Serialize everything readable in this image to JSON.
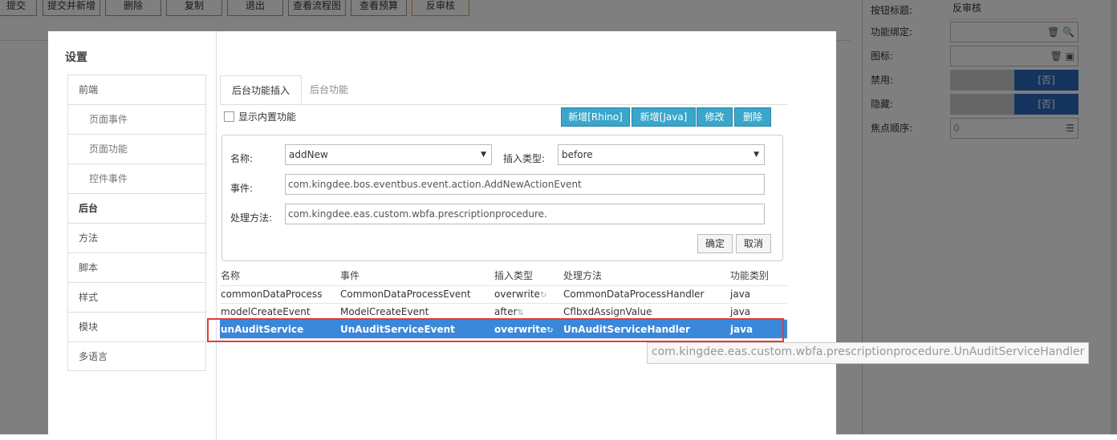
{
  "toolbar": {
    "buttons": [
      "提交",
      "提交并新增",
      "删除",
      "复制",
      "退出",
      "查看流程图",
      "查看预算",
      "反审核"
    ]
  },
  "properties": {
    "button_title_label": "按钮标题:",
    "button_title_value": "反审核",
    "func_bind_label": "功能绑定:",
    "icon_label": "图标:",
    "disabled_label": "禁用:",
    "disabled_value": "[否]",
    "hidden_label": "隐藏:",
    "hidden_value": "[否]",
    "focus_order_label": "焦点顺序:",
    "focus_order_value": "0"
  },
  "dialog": {
    "title": "设置",
    "nav": [
      {
        "label": "前端",
        "level": "top"
      },
      {
        "label": "页面事件",
        "level": "sub"
      },
      {
        "label": "页面功能",
        "level": "sub"
      },
      {
        "label": "控件事件",
        "level": "sub"
      },
      {
        "label": "后台",
        "level": "top",
        "selected": true
      },
      {
        "label": "方法",
        "level": "top"
      },
      {
        "label": "脚本",
        "level": "top"
      },
      {
        "label": "样式",
        "level": "top"
      },
      {
        "label": "模块",
        "level": "top"
      },
      {
        "label": "多语言",
        "level": "top"
      }
    ],
    "tabs": [
      "后台功能插入",
      "后台功能"
    ],
    "show_builtin_label": "显示内置功能",
    "actions": [
      "新增[Rhino]",
      "新增[Java]",
      "修改",
      "删除"
    ],
    "form": {
      "name_label": "名称:",
      "name_value": "addNew",
      "insert_type_label": "插入类型:",
      "insert_type_value": "before",
      "event_label": "事件:",
      "event_value": "com.kingdee.bos.eventbus.event.action.AddNewActionEvent",
      "handler_label": "处理方法:",
      "handler_value": "com.kingdee.eas.custom.wbfa.prescriptionprocedure.",
      "ok_label": "确定",
      "cancel_label": "取消"
    },
    "grid": {
      "headers": [
        "名称",
        "事件",
        "插入类型",
        "处理方法",
        "功能类别"
      ],
      "rows": [
        [
          "commonDataProcess",
          "CommonDataProcessEvent",
          "overwrite",
          "CommonDataProcessHandler",
          "java"
        ],
        [
          "modelCreateEvent",
          "ModelCreateEvent",
          "after",
          "CflbxdAssignValue",
          "java"
        ],
        [
          "unAuditService",
          "UnAuditServiceEvent",
          "overwrite",
          "UnAuditServiceHandler",
          "java"
        ]
      ],
      "selected_row": 2
    },
    "tooltip": "com.kingdee.eas.custom.wbfa.prescriptionprocedure.UnAuditServiceHandler"
  },
  "colors": {
    "accent_blue": "#3b87d9",
    "action_button": "#3aa6c9",
    "highlight_border": "#e23b3b",
    "toggle_on": "#2a6bbf"
  }
}
